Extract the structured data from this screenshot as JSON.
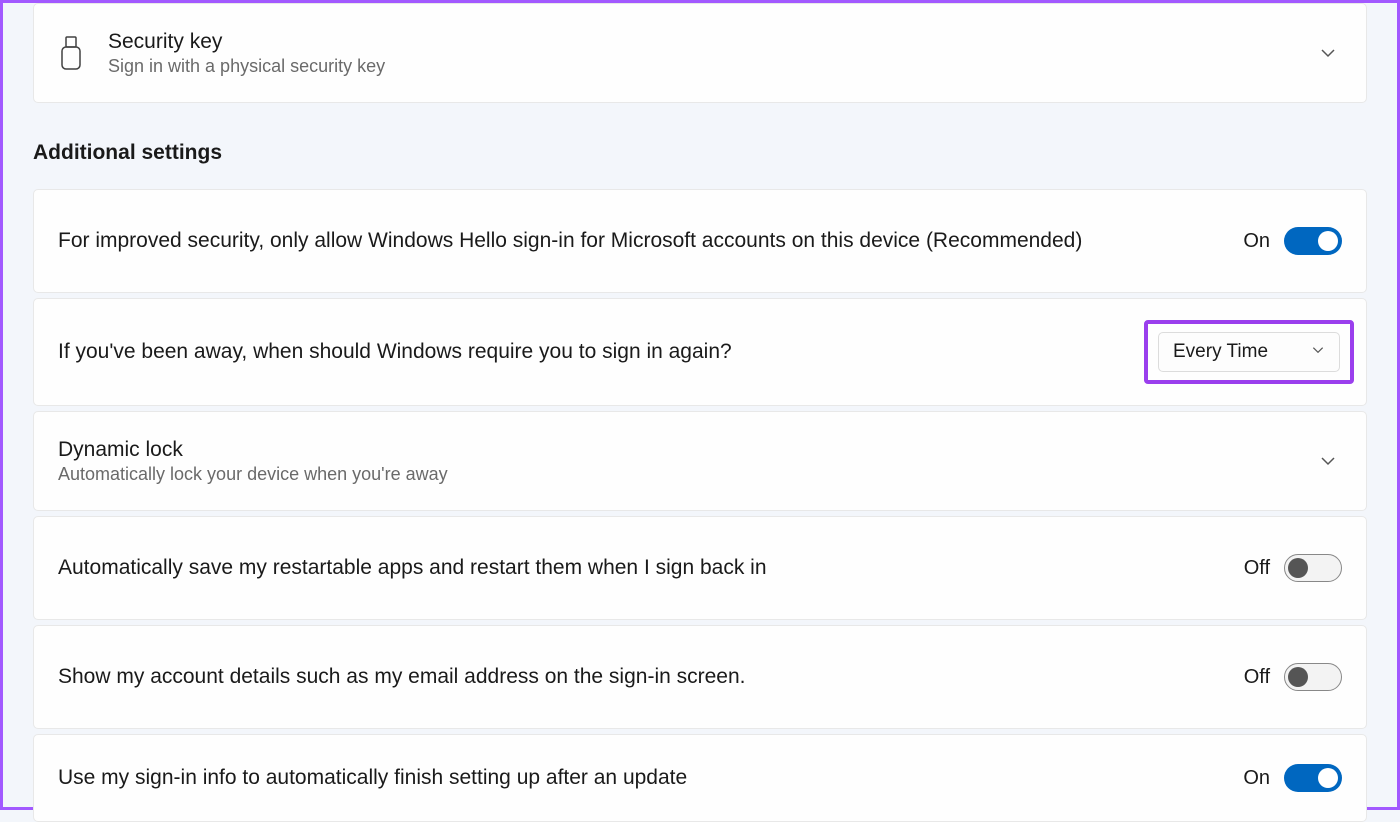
{
  "security_key": {
    "title": "Security key",
    "subtitle": "Sign in with a physical security key"
  },
  "section_header": "Additional settings",
  "hello_only": {
    "label": "For improved security, only allow Windows Hello sign-in for Microsoft accounts on this device (Recommended)",
    "state": "On"
  },
  "require_signin": {
    "label": "If you've been away, when should Windows require you to sign in again?",
    "value": "Every Time"
  },
  "dynamic_lock": {
    "title": "Dynamic lock",
    "subtitle": "Automatically lock your device when you're away"
  },
  "restartable_apps": {
    "label": "Automatically save my restartable apps and restart them when I sign back in",
    "state": "Off"
  },
  "account_details": {
    "label": "Show my account details such as my email address on the sign-in screen.",
    "state": "Off"
  },
  "finish_setup": {
    "label": "Use my sign-in info to automatically finish setting up after an update",
    "state": "On"
  }
}
